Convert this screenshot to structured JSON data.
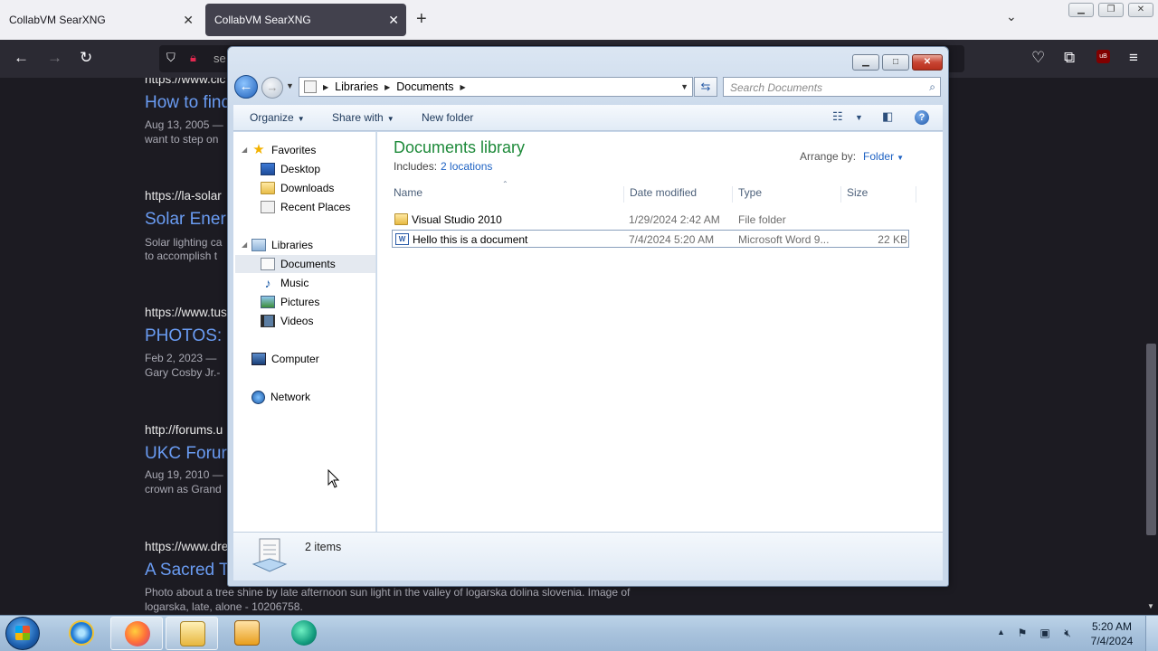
{
  "browser": {
    "tabs": [
      {
        "title": "CollabVM SearXNG",
        "active": false
      },
      {
        "title": "CollabVM SearXNG",
        "active": true
      }
    ],
    "new_tab_icon": "+",
    "url_fragment": "se"
  },
  "results": [
    {
      "url": "https://www.cic",
      "title": "How to find",
      "snippet": [
        "Aug 13, 2005 —",
        "want to step on"
      ]
    },
    {
      "url": "https://la-solar",
      "title": "Solar Ener",
      "snippet": [
        "Solar lighting ca",
        "to accomplish t"
      ]
    },
    {
      "url": "https://www.tus",
      "title": "PHOTOS: ",
      "snippet": [
        "Feb 2, 2023 —",
        "Gary Cosby Jr.-"
      ]
    },
    {
      "url": "http://forums.u",
      "title": "UKC Forur",
      "snippet": [
        "Aug 19, 2010 —",
        "crown as Grand"
      ]
    },
    {
      "url": "https://www.dre",
      "title": "A Sacred T",
      "snippet": [
        "Photo about a tree shine by late afternoon sun light in the valley of logarska dolina slovenia. Image of",
        "logarska, late, alone - 10206758."
      ]
    }
  ],
  "explorer": {
    "breadcrumb": [
      "Libraries",
      "Documents"
    ],
    "search_placeholder": "Search Documents",
    "commands": {
      "organize": "Organize",
      "share_with": "Share with",
      "new_folder": "New folder"
    },
    "nav": {
      "favorites": "Favorites",
      "desktop": "Desktop",
      "downloads": "Downloads",
      "recent_places": "Recent Places",
      "libraries": "Libraries",
      "documents": "Documents",
      "music": "Music",
      "pictures": "Pictures",
      "videos": "Videos",
      "computer": "Computer",
      "network": "Network"
    },
    "library_title": "Documents library",
    "includes_label": "Includes:",
    "includes_link": "2 locations",
    "arrange_label": "Arrange by:",
    "arrange_value": "Folder",
    "columns": {
      "name": "Name",
      "date": "Date modified",
      "type": "Type",
      "size": "Size"
    },
    "files": [
      {
        "name": "Visual Studio 2010",
        "date": "1/29/2024 2:42 AM",
        "type": "File folder",
        "size": ""
      },
      {
        "name": "Hello this is a document",
        "date": "7/4/2024 5:20 AM",
        "type": "Microsoft Word 9...",
        "size": "22 KB"
      }
    ],
    "status": "2 items"
  },
  "taskbar": {
    "clock_time": "5:20 AM",
    "clock_date": "7/4/2024"
  },
  "colors": {
    "library_title": "#1e8a3a",
    "link": "#1e62c3",
    "result_title": "#6a9cf3"
  }
}
